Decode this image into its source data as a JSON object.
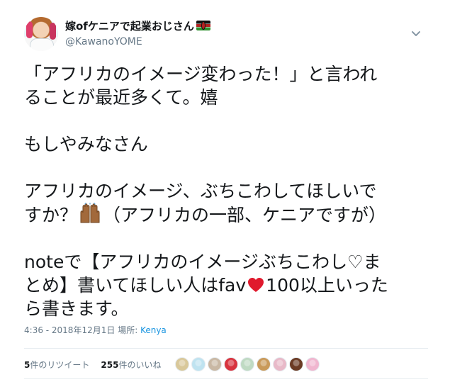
{
  "author": {
    "display_name": "嫁ofケニアで起業おじさん",
    "handle": "@KawanoYOME",
    "flag": "kenya-flag-icon"
  },
  "tweet": {
    "lines": [
      "「アフリカのイメージ変わった！」と言われ",
      "ることが最近多くて。嬉",
      "",
      "もしやみなさん",
      "",
      "アフリカのイメージ、ぶちこわしてほしいで",
      "すか？",
      "（アフリカの一部、ケニアですが）",
      "",
      "noteで【アフリカのイメージぶちこわし♡ま",
      "とめ】書いてほしい人はfav",
      "100以上いった",
      "ら書きます。"
    ]
  },
  "meta": {
    "time": "4:36 - 2018年12月1日",
    "place_label": "場所:",
    "place": "Kenya"
  },
  "stats": {
    "retweet_count": "5",
    "retweet_label": "件のリツイート",
    "like_count": "255",
    "like_label": "件のいいね"
  },
  "icons": {
    "chevron": "chevron-down-icon",
    "hands": "raised-hands-emoji",
    "heart": "red-heart-emoji"
  },
  "colors": {
    "text": "#14171a",
    "secondary": "#657786",
    "link": "#1b95e0",
    "divider": "#e6ecf0"
  },
  "likers": [
    {
      "color": "#d9c89a"
    },
    {
      "color": "#bfe3f0"
    },
    {
      "color": "#c9b8a4"
    },
    {
      "color": "#d8343f"
    },
    {
      "color": "#bfdac3"
    },
    {
      "color": "#c99a5a"
    },
    {
      "color": "#e8b9c8"
    },
    {
      "color": "#6b3b24"
    },
    {
      "color": "#f0b6cf"
    }
  ]
}
